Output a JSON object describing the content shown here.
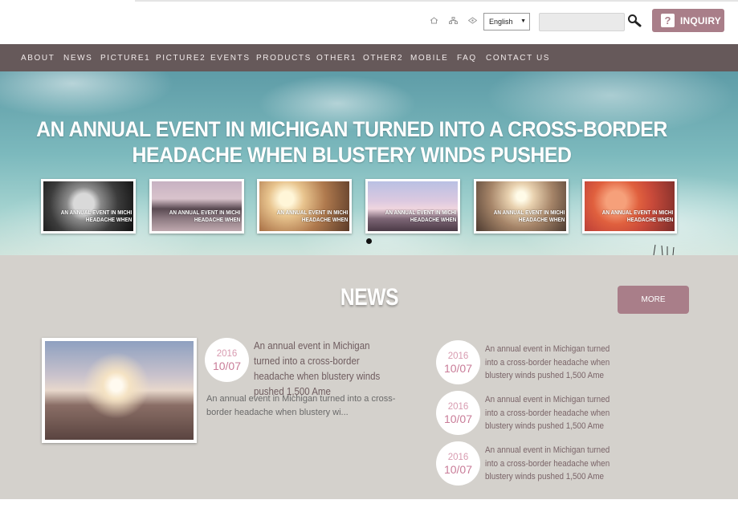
{
  "header": {
    "icons": [
      "home-icon",
      "sitemap-icon",
      "bookmark-icon"
    ],
    "language": {
      "selected": "English"
    },
    "search": {
      "placeholder": "",
      "value": ""
    },
    "inquiry": {
      "icon": "?",
      "label": "INQUIRY"
    }
  },
  "nav": {
    "items": [
      {
        "label": "ABOUT"
      },
      {
        "label": "NEWS"
      },
      {
        "label": "PICTURE1"
      },
      {
        "label": "PICTURE2"
      },
      {
        "label": "EVENTS"
      },
      {
        "label": "PRODUCTS"
      },
      {
        "label": "OTHER1"
      },
      {
        "label": "OTHER2"
      },
      {
        "label": "MOBILE"
      },
      {
        "label": "FAQ"
      },
      {
        "label": "CONTACT US"
      }
    ]
  },
  "hero": {
    "title_line1": "AN ANNUAL EVENT IN MICHIGAN TURNED INTO A CROSS-BORDER",
    "title_line2": "HEADACHE WHEN BLUSTERY WINDS PUSHED",
    "thumbnails": [
      {
        "line1": "AN ANNUAL EVENT IN MICHI",
        "line2": "HEADACHE WHEN",
        "image": "child-portrait"
      },
      {
        "line1": "AN ANNUAL EVENT IN MICHI",
        "line2": "HEADACHE WHEN",
        "image": "rocky-coast"
      },
      {
        "line1": "AN ANNUAL EVENT IN MICHI",
        "line2": "HEADACHE WHEN",
        "image": "sunset-figure"
      },
      {
        "line1": "AN ANNUAL EVENT IN MICHI",
        "line2": "HEADACHE WHEN",
        "image": "pier-sky"
      },
      {
        "line1": "AN ANNUAL EVENT IN MICHI",
        "line2": "HEADACHE WHEN",
        "image": "sunrise-field"
      },
      {
        "line1": "AN ANNUAL EVENT IN MICHI",
        "line2": "HEADACHE WHEN",
        "image": "red-flowers"
      }
    ],
    "active_slide": 1
  },
  "news": {
    "title": "NEWS",
    "more_label": "MORE",
    "feature": {
      "year": "2016",
      "date": "10/07",
      "headline": "An annual event in Michigan turned into a cross-border headache when blustery winds pushed 1,500 Ame",
      "excerpt": "An annual event in Michigan turned into a cross-border headache when blustery wi..."
    },
    "list": [
      {
        "year": "2016",
        "date": "10/07",
        "text": "An annual event in Michigan turned into a cross-border headache when blustery winds pushed 1,500 Ame"
      },
      {
        "year": "2016",
        "date": "10/07",
        "text": "An annual event in Michigan turned into a cross-border headache when blustery winds pushed 1,500 Ame"
      },
      {
        "year": "2016",
        "date": "10/07",
        "text": "An annual event in Michigan turned into a cross-border headache when blustery winds pushed 1,500 Ame"
      }
    ]
  }
}
